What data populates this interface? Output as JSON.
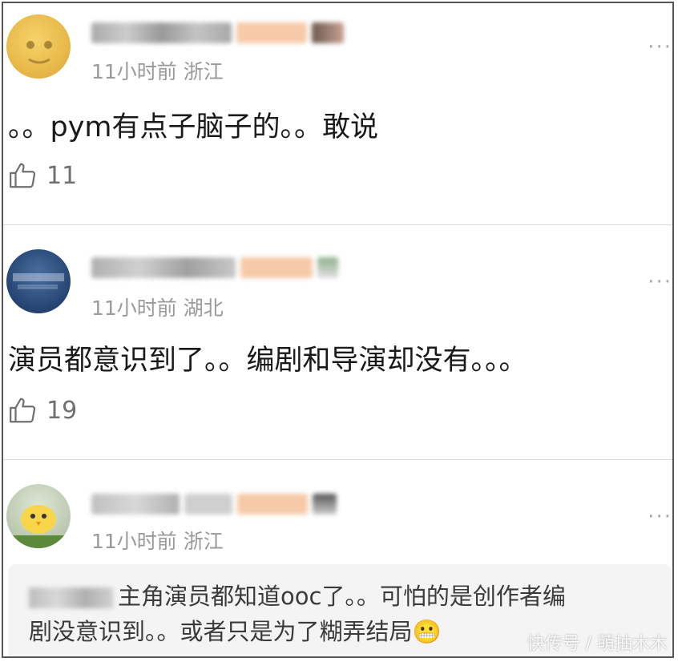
{
  "comments": [
    {
      "meta": "11小时前  浙江",
      "text": "。。pym有点子脑子的。。敢说",
      "likes": "11",
      "more": "···"
    },
    {
      "meta": "11小时前  湖北",
      "text": "演员都意识到了。。编剧和导演却没有。。。",
      "likes": "19",
      "more": "···"
    },
    {
      "meta": "11小时前  浙江",
      "more": "···",
      "reply": {
        "text_line1": "主角演员都知道ooc了。。可怕的是创作者编",
        "text_line2": "剧没意识到。。或者只是为了糊弄结局",
        "emoji": "😬"
      }
    }
  ],
  "watermark": "快传号 / 萌抽木木",
  "colors": {
    "meta": "#9a9a9a",
    "text": "#1a1a1a",
    "like": "#707070",
    "reply_bg": "#f4f4f4"
  },
  "icons": {
    "like": "thumbs-up-icon",
    "more": "more-dots-icon"
  }
}
